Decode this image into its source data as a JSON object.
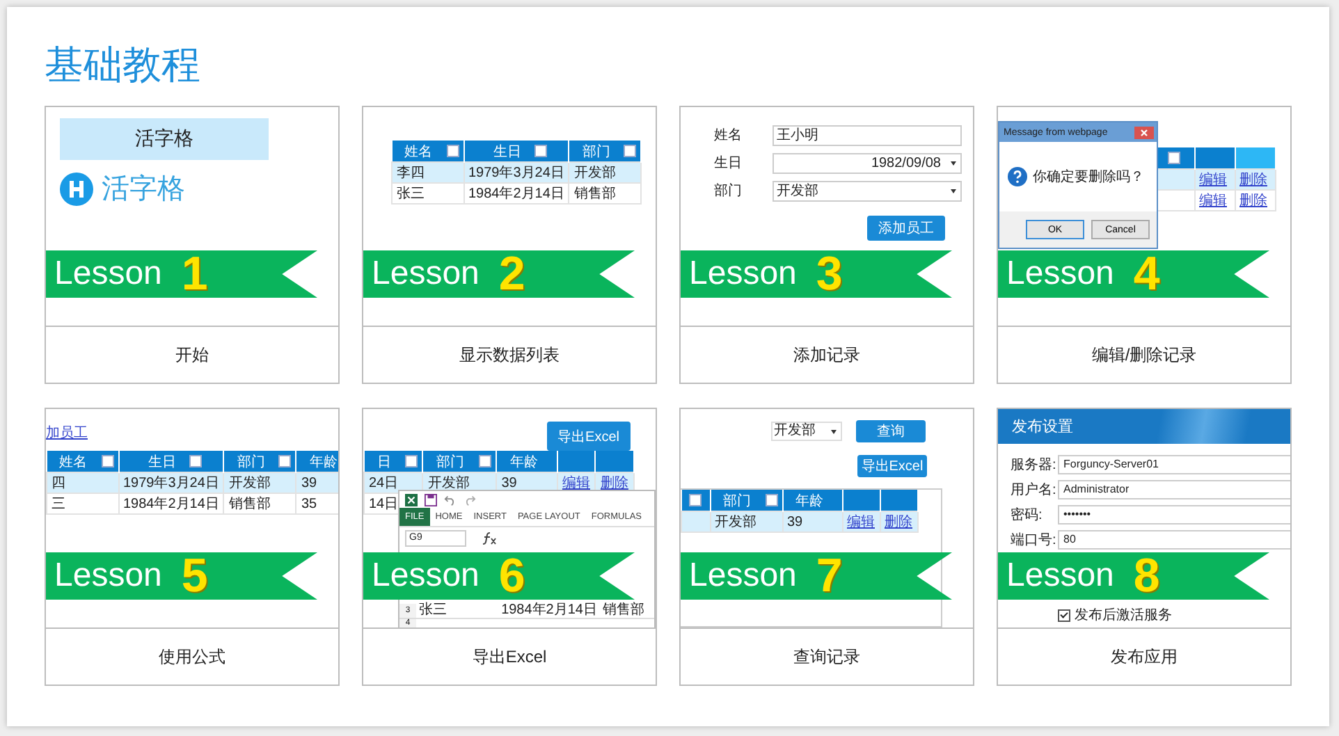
{
  "title": "基础教程",
  "lessons": [
    {
      "label": "Lesson",
      "number": "1",
      "caption": "开始",
      "preview": {
        "kind": "logo",
        "box_text": "活字格",
        "logo_text": "活字格"
      }
    },
    {
      "label": "Lesson",
      "number": "2",
      "caption": "显示数据列表",
      "preview": {
        "kind": "table",
        "columns": [
          {
            "label": "姓名",
            "filter": true
          },
          {
            "label": "生日",
            "filter": true
          },
          {
            "label": "部门",
            "filter": true
          }
        ],
        "rows": [
          {
            "cells": [
              "李四",
              "1979年3月24日",
              "开发部"
            ],
            "selected": true
          },
          {
            "cells": [
              "张三",
              "1984年2月14日",
              "销售部"
            ],
            "selected": false
          }
        ]
      }
    },
    {
      "label": "Lesson",
      "number": "3",
      "caption": "添加记录",
      "preview": {
        "kind": "form",
        "fields": [
          {
            "label": "姓名",
            "value": "王小明",
            "kind": "text"
          },
          {
            "label": "生日",
            "value": "1982/09/08",
            "kind": "date"
          },
          {
            "label": "部门",
            "value": "开发部",
            "kind": "select"
          }
        ],
        "button": "添加员工"
      }
    },
    {
      "label": "Lesson",
      "number": "4",
      "caption": "编辑/删除记录",
      "preview": {
        "kind": "dialog",
        "dialog_title": "Message from webpage",
        "message": "你确定要删除吗？",
        "buttons": [
          "OK",
          "Cancel"
        ],
        "columns": [
          {
            "filter": true
          }
        ],
        "rows": [
          {
            "cells": [],
            "links": [
              "编辑",
              "删除"
            ],
            "selected": true
          },
          {
            "cells": [],
            "links": [
              "编辑",
              "删除"
            ],
            "selected": false
          }
        ]
      }
    },
    {
      "label": "Lesson",
      "number": "5",
      "caption": "使用公式",
      "preview": {
        "kind": "table",
        "link": "加员工",
        "columns": [
          {
            "label": "姓名",
            "filter": true
          },
          {
            "label": "生日",
            "filter": true
          },
          {
            "label": "部门",
            "filter": true
          },
          {
            "label": "年龄",
            "filter": false
          }
        ],
        "rows": [
          {
            "cells": [
              "四",
              "1979年3月24日",
              "开发部",
              "39"
            ],
            "selected": true
          },
          {
            "cells": [
              "三",
              "1984年2月14日",
              "销售部",
              "35"
            ],
            "selected": false
          }
        ]
      }
    },
    {
      "label": "Lesson",
      "number": "6",
      "caption": "导出Excel",
      "preview": {
        "kind": "excel",
        "button": "导出Excel",
        "columns": [
          {
            "label": "日",
            "filter": true
          },
          {
            "label": "部门",
            "filter": true
          },
          {
            "label": "年龄",
            "filter": false
          }
        ],
        "rows": [
          {
            "cells": [
              "24日",
              "开发部",
              "39"
            ],
            "links": [
              "编辑",
              "删除"
            ],
            "selected": true
          },
          {
            "cells": [
              "14日"
            ],
            "selected": false
          }
        ],
        "ribbon_tabs": [
          {
            "label": "FILE",
            "selected": true
          },
          {
            "label": "HOME",
            "selected": false
          },
          {
            "label": "INSERT",
            "selected": false
          },
          {
            "label": "PAGE LAYOUT",
            "selected": false
          },
          {
            "label": "FORMULAS",
            "selected": false
          }
        ],
        "name_box": "G9",
        "sheet_rows": [
          {
            "number": "3",
            "cells": [
              "张三",
              "1984年2月14日",
              "销售部"
            ]
          },
          {
            "number": "4",
            "cells": []
          }
        ]
      }
    },
    {
      "label": "Lesson",
      "number": "7",
      "caption": "查询记录",
      "preview": {
        "kind": "query",
        "select": "开发部",
        "buttons": [
          "查询",
          "导出Excel"
        ],
        "columns": [
          {
            "filter": true
          },
          {
            "label": "部门",
            "filter": true
          },
          {
            "label": "年龄",
            "filter": false
          }
        ],
        "rows": [
          {
            "cells": [
              "",
              "开发部",
              "39"
            ],
            "links": [
              "编辑",
              "删除"
            ],
            "selected": true
          }
        ]
      }
    },
    {
      "label": "Lesson",
      "number": "8",
      "caption": "发布应用",
      "preview": {
        "kind": "publish",
        "header": "发布设置",
        "fields": [
          {
            "label": "服务器:",
            "value": "Forguncy-Server01"
          },
          {
            "label": "用户名:",
            "value": "Administrator"
          },
          {
            "label": "密码:",
            "value": "•••••••"
          },
          {
            "label": "端口号:",
            "value": "80"
          }
        ],
        "checkbox": {
          "label": "发布后激活服务",
          "checked": true
        }
      }
    }
  ]
}
